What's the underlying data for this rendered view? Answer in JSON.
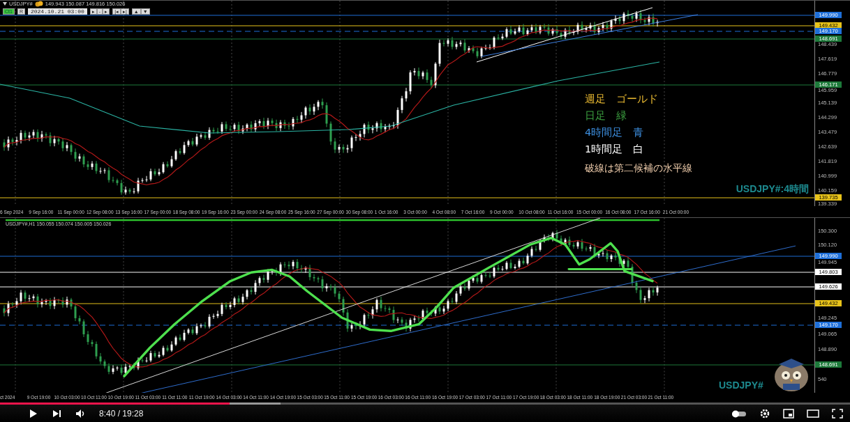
{
  "toolbar": {
    "symbol": "USDJPY#",
    "quote": "149.943 150.087 149.816 150.026",
    "mode_button": "Ct1",
    "reset_button": "R",
    "date_field": "2024.10.21 03:00",
    "nav_buttons": [
      "▸",
      "-",
      "▸"
    ],
    "scroll_buttons": [
      "|◂",
      "▸|"
    ],
    "zoom_buttons": [
      "▲",
      "▼"
    ]
  },
  "upper_chart": {
    "price_labels": [
      "148.439",
      "147.619",
      "146.779",
      "145.959",
      "145.139",
      "144.299",
      "143.479",
      "142.639",
      "141.819",
      "140.999",
      "140.159",
      "139.339"
    ],
    "price_badges": [
      {
        "text": "149.990",
        "color": "#1e6fd9"
      },
      {
        "text": "149.432",
        "color": "#e8c31a"
      },
      {
        "text": "149.170",
        "color": "#1e6fd9"
      },
      {
        "text": "148.691",
        "color": "#1d7a3a"
      },
      {
        "text": "146.171",
        "color": "#1d7a3a"
      },
      {
        "text": "139.735",
        "color": "#e8c31a"
      }
    ],
    "legend": [
      {
        "text": "週足　ゴールド",
        "color": "#e8b830"
      },
      {
        "text": "日足　緑",
        "color": "#3ca040"
      },
      {
        "text": "4時間足　青",
        "color": "#3d8fe0"
      },
      {
        "text": "1時間足　白",
        "color": "#ffffff"
      },
      {
        "text": "破線は第二候補の水平線",
        "color": "#f2cfae"
      }
    ],
    "watermark": "USDJPY#:4時間",
    "time_labels": [
      "6 Sep 2024",
      "9 Sep 16:00",
      "11 Sep 00:00",
      "12 Sep 08:00",
      "13 Sep 16:00",
      "17 Sep 00:00",
      "18 Sep 08:00",
      "19 Sep 16:00",
      "23 Sep 00:00",
      "24 Sep 08:00",
      "25 Sep 16:00",
      "27 Sep 00:00",
      "30 Sep 08:00",
      "1 Oct 16:00",
      "3 Oct 00:00",
      "4 Oct 08:00",
      "7 Oct 16:00",
      "9 Oct 00:00",
      "10 Oct 08:00",
      "11 Oct 16:00",
      "15 Oct 00:00",
      "16 Oct 08:00",
      "17 Oct 16:00",
      "21 Oct 00:00"
    ]
  },
  "lower_chart": {
    "header": "USDJPY#,H1 150.055 150.074 150.005 150.026",
    "price_labels": [
      "150.300",
      "150.120",
      "149.945",
      "149.245",
      "149.065",
      "148.890",
      "540"
    ],
    "price_badges": [
      {
        "text": "149.990",
        "color": "#1e6fd9"
      },
      {
        "text": "149.803",
        "color": "#ffffff"
      },
      {
        "text": "149.626",
        "color": "#ffffff"
      },
      {
        "text": "149.432",
        "color": "#e8c31a"
      },
      {
        "text": "149.170",
        "color": "#1e6fd9"
      },
      {
        "text": "148.691",
        "color": "#1d7a3a"
      }
    ],
    "watermark": "USDJPY#",
    "time_labels": [
      "ct 2024",
      "9 Oct 19:00",
      "10 Oct 03:00",
      "10 Oct 11:00",
      "10 Oct 19:00",
      "11 Oct 03:00",
      "11 Oct 11:00",
      "11 Oct 19:00",
      "14 Oct 03:00",
      "14 Oct 11:00",
      "14 Oct 19:00",
      "15 Oct 03:00",
      "15 Oct 11:00",
      "15 Oct 19:00",
      "16 Oct 03:00",
      "16 Oct 11:00",
      "16 Oct 19:00",
      "17 Oct 03:00",
      "17 Oct 11:00",
      "17 Oct 19:00",
      "18 Oct 03:00",
      "18 Oct 11:00",
      "18 Oct 19:00",
      "21 Oct 03:00",
      "21 Oct 11:00"
    ]
  },
  "video_player": {
    "progress": {
      "level": 0.27
    },
    "time": "8:40 / 19:28"
  }
}
